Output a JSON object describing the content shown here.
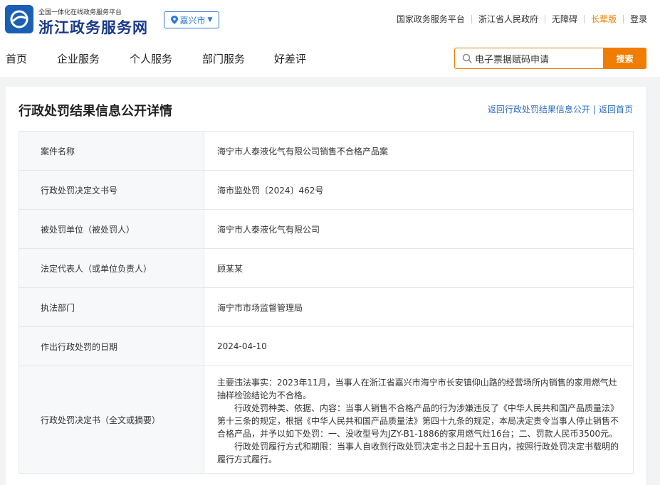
{
  "header": {
    "subtitle": "全国一体化在线政务服务平台",
    "site_name": "浙江政务服务网",
    "city": "嘉兴市",
    "links": [
      "国家政务服务平台",
      "浙江省人民政府",
      "无障碍",
      "长辈版",
      "登录"
    ]
  },
  "nav": {
    "items": [
      "首页",
      "企业服务",
      "个人服务",
      "部门服务",
      "好差评"
    ]
  },
  "search": {
    "value": "电子票据赋码申请",
    "button": "搜索"
  },
  "page": {
    "title": "行政处罚结果信息公开详情",
    "back_link": "返回行政处罚结果信息公开",
    "separator": "|",
    "home_link": "返回首页"
  },
  "rows": [
    {
      "key": "案件名称",
      "value": "海宁市人泰液化气有限公司销售不合格产品案"
    },
    {
      "key": "行政处罚决定文书号",
      "value": "海市监处罚〔2024〕462号"
    },
    {
      "key": "被处罚单位（被处罚人）",
      "value": "海宁市人泰液化气有限公司"
    },
    {
      "key": "法定代表人（或单位负责人）",
      "value": "顾某某"
    },
    {
      "key": "执法部门",
      "value": "海宁市市场监督管理局"
    },
    {
      "key": "作出行政处罚的日期",
      "value": "2024-04-10"
    }
  ],
  "decision": {
    "key": "行政处罚决定书（全文或摘要）",
    "p1": "主要违法事实：2023年11月，当事人在浙江省嘉兴市海宁市长安镇仰山路的经营场所内销售的家用燃气灶抽样检验结论为不合格。",
    "p2": "行政处罚种类、依据、内容：当事人销售不合格产品的行为涉嫌违反了《中华人民共和国产品质量法》第十三条的规定，根据《中华人民共和国产品质量法》第四十九条的规定，本局决定责令当事人停止销售不合格产品，并予以如下处罚：一、没收型号为JZY-B1-1886的家用燃气灶16台；二、罚款人民币3500元。",
    "p3": "行政处罚履行方式和期限：当事人自收到行政处罚决定书之日起十五日内，按照行政处罚决定书载明的履行方式履行。"
  },
  "colors": {
    "brand_blue": "#1a5fb4",
    "link_blue": "#2e6ec4",
    "accent_orange": "#f07c00"
  }
}
